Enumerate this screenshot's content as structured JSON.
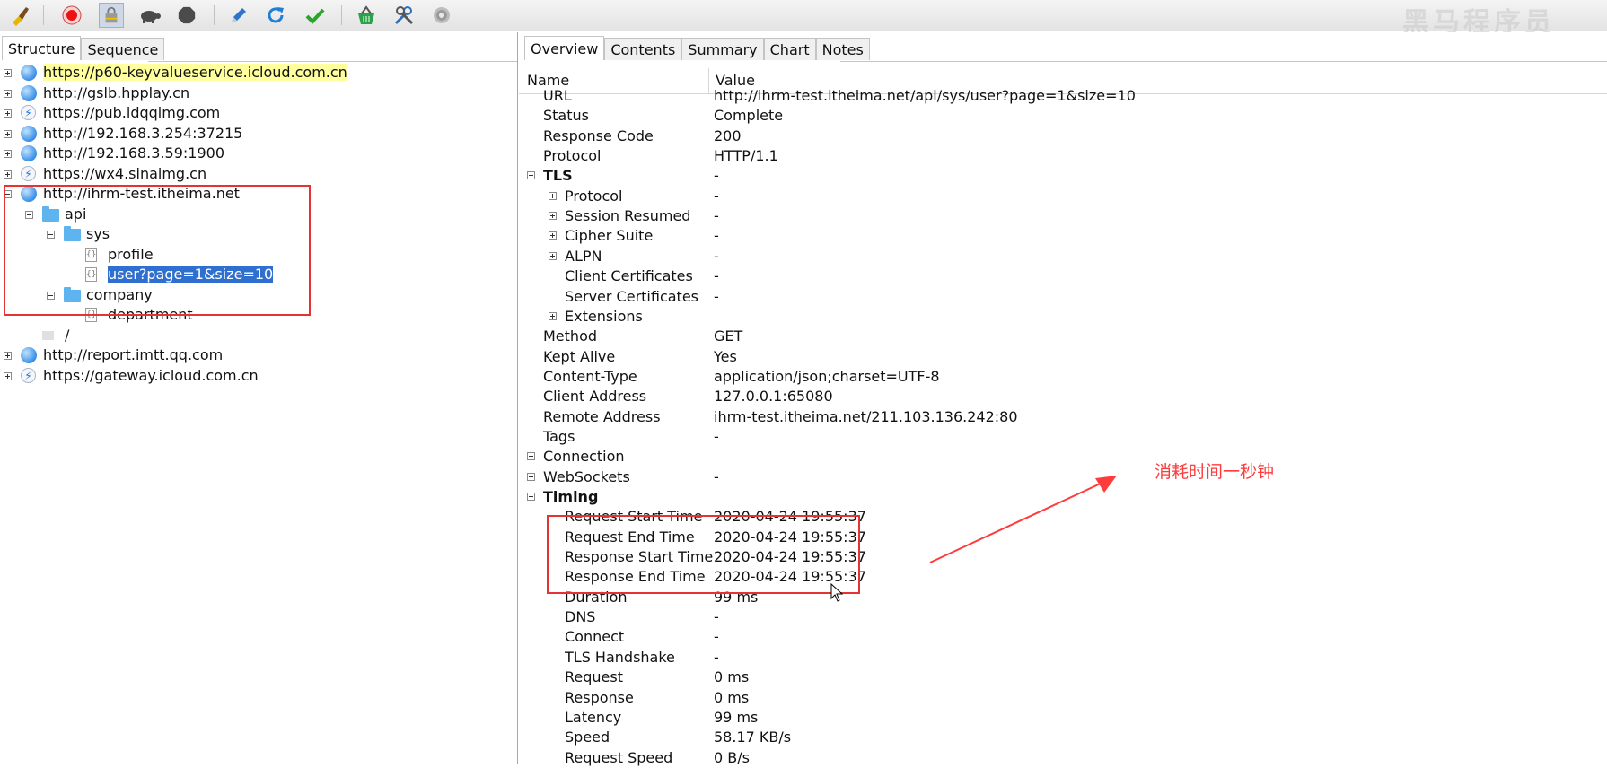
{
  "watermark": "黑马程序员",
  "toolbar": {
    "icons": [
      "broom-icon",
      "record-icon",
      "lock-icon",
      "turtle-icon",
      "stop-icon",
      "pen-icon",
      "refresh-icon",
      "check-icon",
      "basket-icon",
      "tools-icon",
      "gear-icon"
    ]
  },
  "left": {
    "tabs": [
      "Structure",
      "Sequence"
    ],
    "tree": [
      {
        "label": "https://p60-keyvalueservice.icloud.com.cn",
        "icon": "globe-icon",
        "state": "plus",
        "highlight": "yellow"
      },
      {
        "label": "http://gslb.hpplay.cn",
        "icon": "globe-icon",
        "state": "plus"
      },
      {
        "label": "https://pub.idqqimg.com",
        "icon": "bolt-icon",
        "state": "plus"
      },
      {
        "label": "http://192.168.3.254:37215",
        "icon": "globe-icon",
        "state": "plus"
      },
      {
        "label": "http://192.168.3.59:1900",
        "icon": "globe-icon",
        "state": "plus"
      },
      {
        "label": "https://wx4.sinaimg.cn",
        "icon": "bolt-icon",
        "state": "plus"
      },
      {
        "label": "http://ihrm-test.itheima.net",
        "icon": "globe-icon",
        "state": "minus"
      },
      {
        "label": "api",
        "icon": "folder-icon",
        "state": "minus"
      },
      {
        "label": "sys",
        "icon": "folder-icon",
        "state": "minus"
      },
      {
        "label": "profile",
        "icon": "doc-icon"
      },
      {
        "label": "user?page=1&size=10",
        "icon": "doc-icon",
        "highlight": "selected"
      },
      {
        "label": "company",
        "icon": "folder-icon",
        "state": "minus"
      },
      {
        "label": "department",
        "icon": "doc-icon"
      },
      {
        "label": "/",
        "icon": "line-icon"
      },
      {
        "label": "http://report.imtt.qq.com",
        "icon": "globe-icon",
        "state": "plus"
      },
      {
        "label": "https://gateway.icloud.com.cn",
        "icon": "bolt-icon",
        "state": "plus"
      }
    ]
  },
  "right": {
    "tabs": [
      "Overview",
      "Contents",
      "Summary",
      "Chart",
      "Notes"
    ],
    "col_name": "Name",
    "col_value": "Value",
    "rows": [
      {
        "name": "URL",
        "value": "http://ihrm-test.itheima.net/api/sys/user?page=1&size=10"
      },
      {
        "name": "Status",
        "value": "Complete"
      },
      {
        "name": "Response Code",
        "value": "200"
      },
      {
        "name": "Protocol",
        "value": "HTTP/1.1"
      },
      {
        "name": "TLS",
        "value": "-",
        "section": true
      },
      {
        "name": "Protocol",
        "value": "-",
        "sub": true,
        "expand": true
      },
      {
        "name": "Session Resumed",
        "value": "-",
        "sub": true,
        "expand": true
      },
      {
        "name": "Cipher Suite",
        "value": "-",
        "sub": true,
        "expand": true
      },
      {
        "name": "ALPN",
        "value": "-",
        "sub": true,
        "expand": true
      },
      {
        "name": "Client Certificates",
        "value": "-",
        "sub": true
      },
      {
        "name": "Server Certificates",
        "value": "-",
        "sub": true
      },
      {
        "name": "Extensions",
        "value": "",
        "sub": true,
        "expand": true
      },
      {
        "name": "Method",
        "value": "GET"
      },
      {
        "name": "Kept Alive",
        "value": "Yes"
      },
      {
        "name": "Content-Type",
        "value": "application/json;charset=UTF-8"
      },
      {
        "name": "Client Address",
        "value": "127.0.0.1:65080"
      },
      {
        "name": "Remote Address",
        "value": "ihrm-test.itheima.net/211.103.136.242:80"
      },
      {
        "name": "Tags",
        "value": "-"
      },
      {
        "name": "Connection",
        "value": "",
        "top_expand": true
      },
      {
        "name": "WebSockets",
        "value": "-",
        "top_expand": true
      },
      {
        "name": "Timing",
        "value": "",
        "section": true
      },
      {
        "name": "Request Start Time",
        "value": "2020-04-24 19:55:37",
        "sub": true
      },
      {
        "name": "Request End Time",
        "value": "2020-04-24 19:55:37",
        "sub": true
      },
      {
        "name": "Response Start Time",
        "value": "2020-04-24 19:55:37",
        "sub": true
      },
      {
        "name": "Response End Time",
        "value": "2020-04-24 19:55:37",
        "sub": true
      },
      {
        "name": "Duration",
        "value": "99 ms",
        "sub": true
      },
      {
        "name": "DNS",
        "value": "-",
        "sub": true
      },
      {
        "name": "Connect",
        "value": "-",
        "sub": true
      },
      {
        "name": "TLS Handshake",
        "value": "-",
        "sub": true
      },
      {
        "name": "Request",
        "value": "0 ms",
        "sub": true
      },
      {
        "name": "Response",
        "value": "0 ms",
        "sub": true
      },
      {
        "name": "Latency",
        "value": "99 ms",
        "sub": true
      },
      {
        "name": "Speed",
        "value": "58.17 KB/s",
        "sub": true
      },
      {
        "name": "Request Speed",
        "value": "0 B/s",
        "sub": true
      }
    ]
  },
  "annotation": {
    "text": "消耗时间一秒钟",
    "color": "#ff3b3b"
  }
}
